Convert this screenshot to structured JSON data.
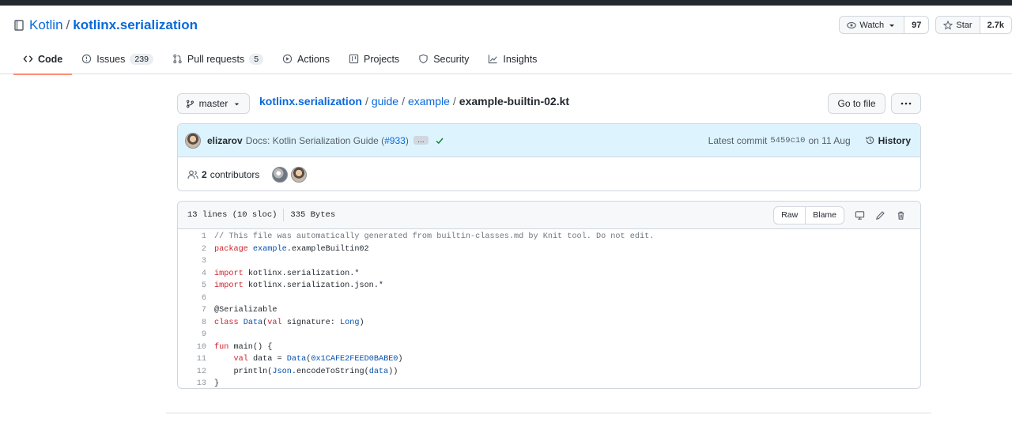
{
  "repo": {
    "owner": "Kotlin",
    "separator": "/",
    "name": "kotlinx.serialization",
    "watch_label": "Watch",
    "watch_count": "97",
    "star_label": "Star",
    "star_count": "2.7k"
  },
  "tabs": [
    {
      "label": "Code",
      "count": ""
    },
    {
      "label": "Issues",
      "count": "239"
    },
    {
      "label": "Pull requests",
      "count": "5"
    },
    {
      "label": "Actions",
      "count": ""
    },
    {
      "label": "Projects",
      "count": ""
    },
    {
      "label": "Security",
      "count": ""
    },
    {
      "label": "Insights",
      "count": ""
    }
  ],
  "file_nav": {
    "branch": "master",
    "breadcrumb": [
      "kotlinx.serialization",
      "guide",
      "example"
    ],
    "file_name": "example-builtin-02.kt",
    "separator": "/",
    "go_to_file": "Go to file"
  },
  "commit": {
    "author": "elizarov",
    "message": "Docs: Kotlin Serialization Guide (",
    "pr_link": "#933",
    "message_end": ")",
    "ellipsis": "…",
    "latest_label": "Latest commit",
    "sha": "5459c10",
    "date": "on 11 Aug",
    "history_label": "History"
  },
  "contributors": {
    "count": "2",
    "label": "contributors"
  },
  "file": {
    "lines_info": "13 lines (10 sloc)",
    "size": "335 Bytes",
    "raw_label": "Raw",
    "blame_label": "Blame"
  },
  "code_lines": [
    "// This file was automatically generated from builtin-classes.md by Knit tool. Do not edit.",
    "package example.exampleBuiltin02",
    "",
    "import kotlinx.serialization.*",
    "import kotlinx.serialization.json.*",
    "",
    "@Serializable",
    "class Data(val signature: Long)",
    "",
    "fun main() {",
    "    val data = Data(0x1CAFE2FEED0BABE0)",
    "    println(Json.encodeToString(data))",
    "}"
  ]
}
